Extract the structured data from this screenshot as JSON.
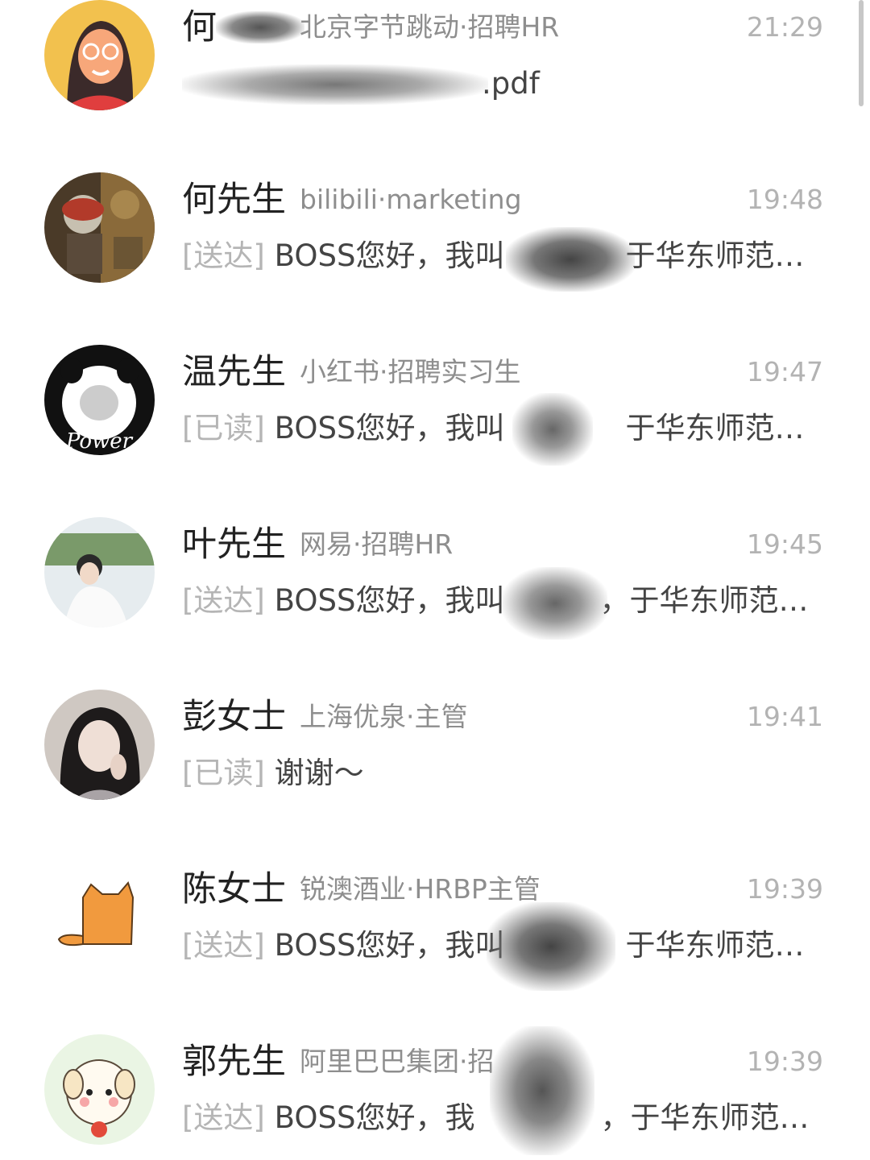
{
  "chats": [
    {
      "name": "何",
      "company": "北京字节跳动·招聘HR",
      "time": "21:29",
      "status": "",
      "message": "",
      "message_tail": ".pdf",
      "avatar": "woman-glasses-avatar-icon"
    },
    {
      "name": "何先生",
      "company": "bilibili·marketing",
      "time": "19:48",
      "status": "[送达]",
      "message": "BOSS您好，我叫",
      "message_tail": "于华东师范…",
      "avatar": "robot-figure-avatar-icon"
    },
    {
      "name": "温先生",
      "company": "小红书·招聘实习生",
      "time": "19:47",
      "status": "[已读]",
      "message": "BOSS您好，我叫",
      "message_tail": "于华东师范…",
      "avatar": "panda-meme-avatar-icon"
    },
    {
      "name": "叶先生",
      "company": "网易·招聘HR",
      "time": "19:45",
      "status": "[送达]",
      "message": "BOSS您好，我叫",
      "message_tail": "，于华东师范…",
      "avatar": "person-photo-avatar-icon"
    },
    {
      "name": "彭女士",
      "company": "上海优泉·主管",
      "time": "19:41",
      "status": "[已读]",
      "message": "谢谢～",
      "message_tail": "",
      "avatar": "girl-photo-avatar-icon"
    },
    {
      "name": "陈女士",
      "company": "锐澳酒业·HRBP主管",
      "time": "19:39",
      "status": "[送达]",
      "message": "BOSS您好，我叫",
      "message_tail": "于华东师范…",
      "avatar": "orange-cat-avatar-icon"
    },
    {
      "name": "郭先生",
      "company": "阿里巴巴集团·招",
      "time": "19:39",
      "status": "[送达]",
      "message": "BOSS您好，我",
      "message_tail": "，于华东师范…",
      "avatar": "puppy-cartoon-avatar-icon"
    }
  ],
  "colors": {
    "name": "#222222",
    "company": "#8e8e8e",
    "time": "#b3b3b3",
    "status": "#b5b5b5",
    "message": "#444444"
  }
}
